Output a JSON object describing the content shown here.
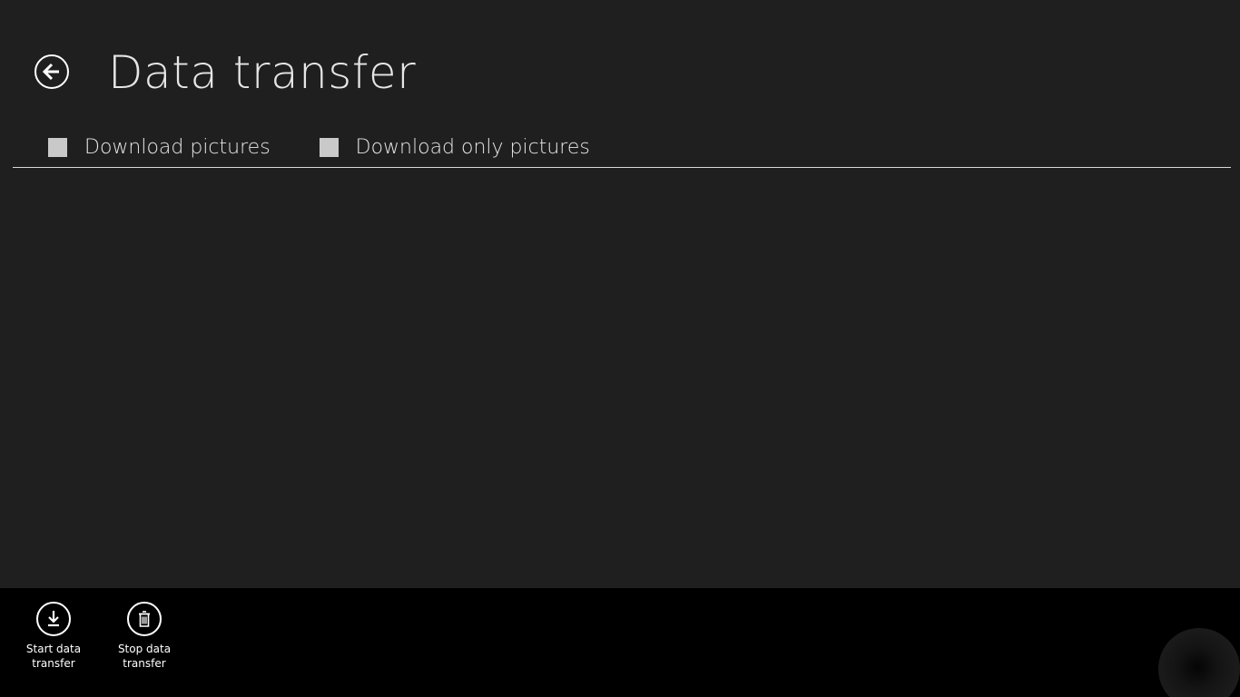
{
  "header": {
    "title": "Data transfer",
    "back_icon": "back-arrow-icon"
  },
  "options": [
    {
      "label": "Download pictures",
      "checked": false
    },
    {
      "label": "Download only pictures",
      "checked": false
    }
  ],
  "app_bar": {
    "buttons": [
      {
        "label": "Start data transfer",
        "icon": "download-icon"
      },
      {
        "label": "Stop data transfer",
        "icon": "trash-icon"
      }
    ]
  },
  "colors": {
    "background": "#1f1f1f",
    "app_bar": "#000000",
    "text": "#e6e6e6",
    "checkbox": "#c9c9c9"
  }
}
